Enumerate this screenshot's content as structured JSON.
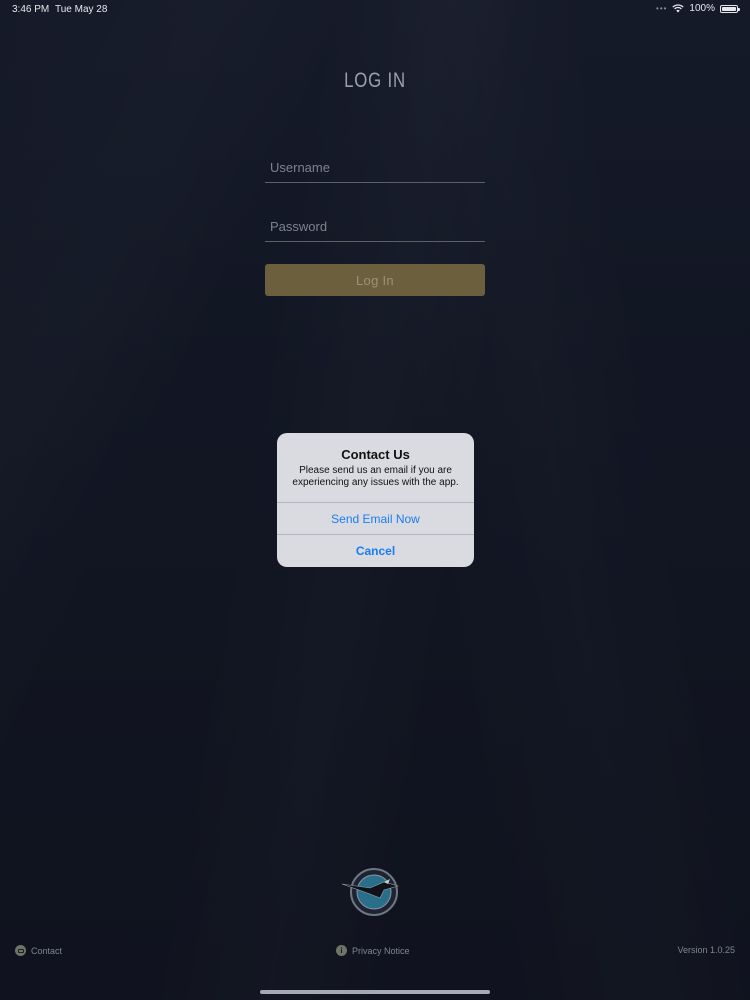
{
  "status_bar": {
    "time": "3:46 PM",
    "date": "Tue May 28",
    "battery": "100%",
    "battery_level": 1.0
  },
  "login": {
    "title": "LOG IN",
    "username_placeholder": "Username",
    "password_placeholder": "Password",
    "login_button": "Log In"
  },
  "alert": {
    "title": "Contact Us",
    "message": "Please send us an email if you are experiencing any issues with the app.",
    "primary_action": "Send Email Now",
    "cancel_action": "Cancel"
  },
  "footer": {
    "contact": "Contact",
    "privacy": "Privacy Notice",
    "version": "Version 1.0.25"
  },
  "icons": {
    "wifi": "wifi-icon",
    "battery": "battery-icon",
    "contact": "mail-icon",
    "privacy": "info-icon",
    "logo": "eagle-logo"
  },
  "colors": {
    "background": "#161b2b",
    "login_button": "#6b5f3e",
    "alert_background": "#d9dbe0",
    "alert_action": "#1a7cf5"
  }
}
